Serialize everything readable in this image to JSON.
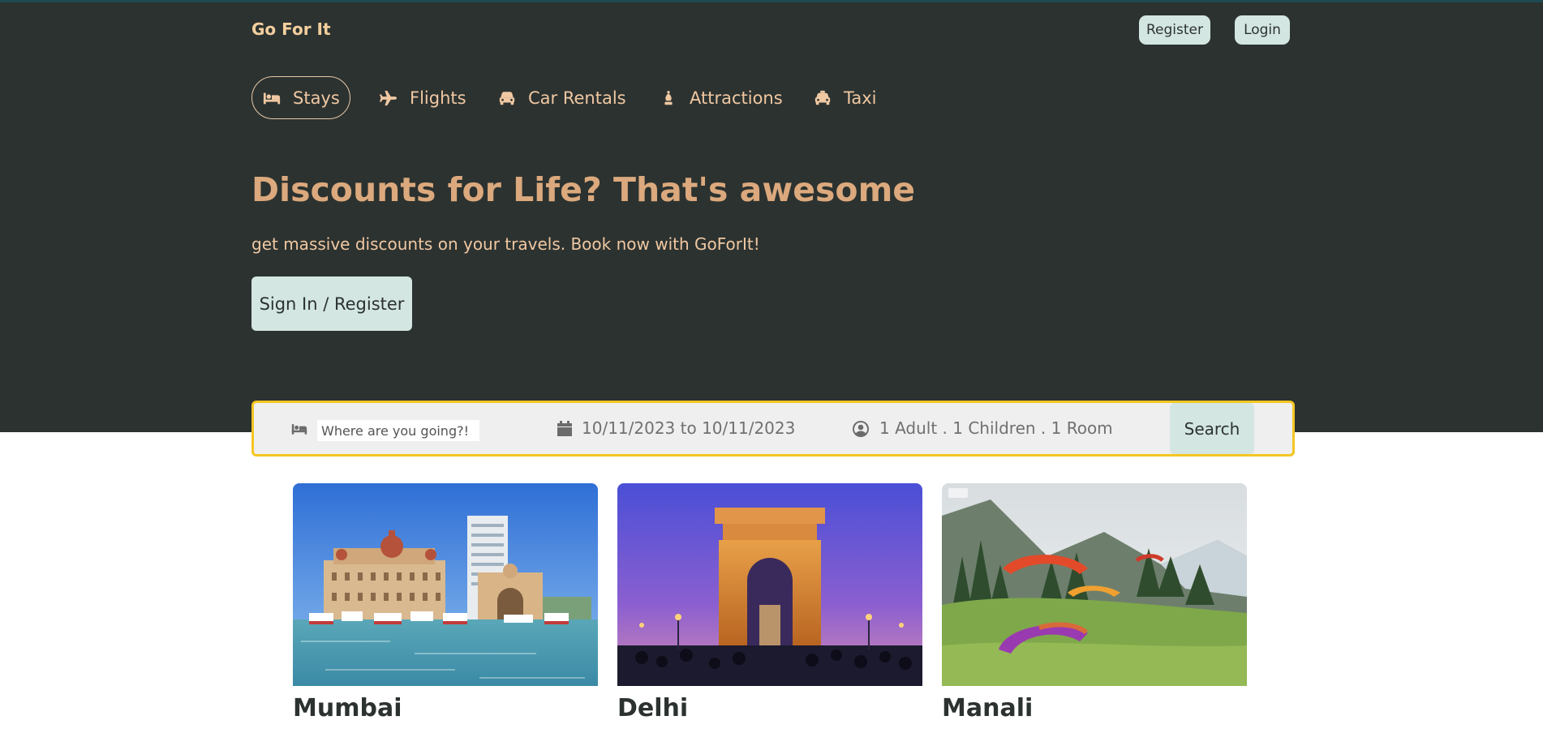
{
  "header": {
    "brand": "Go For It",
    "register_label": "Register",
    "login_label": "Login"
  },
  "nav": {
    "items": [
      {
        "label": "Stays",
        "icon": "bed-icon",
        "active": true
      },
      {
        "label": "Flights",
        "icon": "plane-icon",
        "active": false
      },
      {
        "label": "Car Rentals",
        "icon": "car-icon",
        "active": false
      },
      {
        "label": "Attractions",
        "icon": "chess-bishop-icon",
        "active": false
      },
      {
        "label": "Taxi",
        "icon": "taxi-icon",
        "active": false
      }
    ]
  },
  "hero": {
    "title": "Discounts for Life? That's awesome",
    "subtitle": "get massive discounts on your travels. Book now with GoForIt!",
    "cta_label": "Sign In / Register"
  },
  "search": {
    "destination_placeholder": "Where are you going?!",
    "dates": "10/11/2023 to 10/11/2023",
    "guests": "1 Adult . 1 Children . 1 Room",
    "button_label": "Search"
  },
  "cities": [
    {
      "name": "Mumbai"
    },
    {
      "name": "Delhi"
    },
    {
      "name": "Manali"
    }
  ],
  "colors": {
    "hero_bg": "#2c3230",
    "accent": "#f0c8a2",
    "headline": "#dba97d",
    "button_bg": "#d3e6e1",
    "search_border": "#f5c623"
  }
}
